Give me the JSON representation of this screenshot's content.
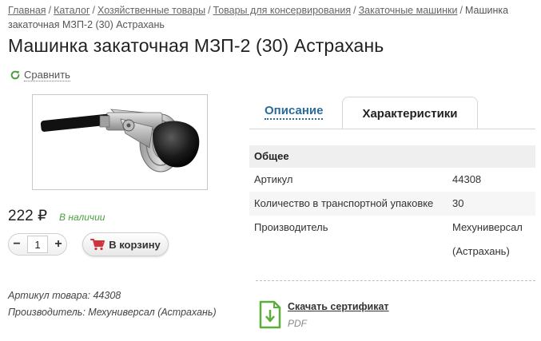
{
  "breadcrumb": {
    "items": [
      "Главная",
      "Каталог",
      "Хозяйственные товары",
      "Товары для консервирования",
      "Закаточные машинки"
    ],
    "current": "Машинка закаточная МЗП-2 (30) Астрахань"
  },
  "product": {
    "title": "Машинка закаточная МЗП-2 (30) Астрахань",
    "compare_label": "Сравнить",
    "price": "222 ₽",
    "availability": "В наличии",
    "quantity": "1",
    "cart_label": "В корзину",
    "meta_article": "Артикул товара: 44308",
    "meta_manufacturer": "Производитель: Мехуниверсал (Астрахань)"
  },
  "tabs": {
    "description": "Описание",
    "characteristics": "Характеристики"
  },
  "specs": {
    "group": "Общее",
    "rows": [
      {
        "key": "Артикул",
        "value": "44308"
      },
      {
        "key": "Количество в транспортной упаковке",
        "value": "30"
      },
      {
        "key": "Производитель",
        "value": "Мехуниверсал (Астрахань)"
      }
    ]
  },
  "certificate": {
    "link": "Скачать сертификат",
    "format": "PDF"
  },
  "icons": {
    "compare": "refresh-icon",
    "cart": "cart-icon",
    "certificate": "download-document-icon"
  },
  "colors": {
    "link_blue": "#2a6b9c",
    "available_green": "#4aa040",
    "cart_red": "#d0313a",
    "cert_green": "#5aae3c"
  }
}
